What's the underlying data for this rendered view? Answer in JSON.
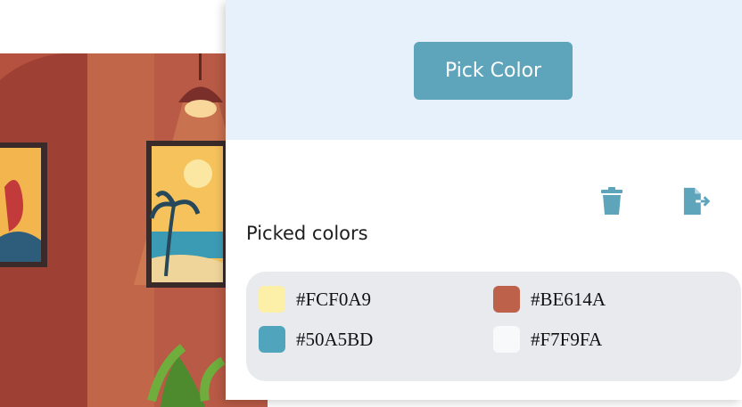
{
  "header": {
    "pick_label": "Pick Color"
  },
  "actions": {
    "clear_icon": "trash-icon",
    "export_icon": "export-file-icon",
    "accent": "#5ea5bc"
  },
  "picked": {
    "title": "Picked colors",
    "colors": [
      {
        "hex": "#FCF0A9",
        "swatch": "#FCF0A9"
      },
      {
        "hex": "#BE614A",
        "swatch": "#BE614A"
      },
      {
        "hex": "#50A5BD",
        "swatch": "#50A5BD"
      },
      {
        "hex": "#F7F9FA",
        "swatch": "#F7F9FA"
      }
    ]
  }
}
